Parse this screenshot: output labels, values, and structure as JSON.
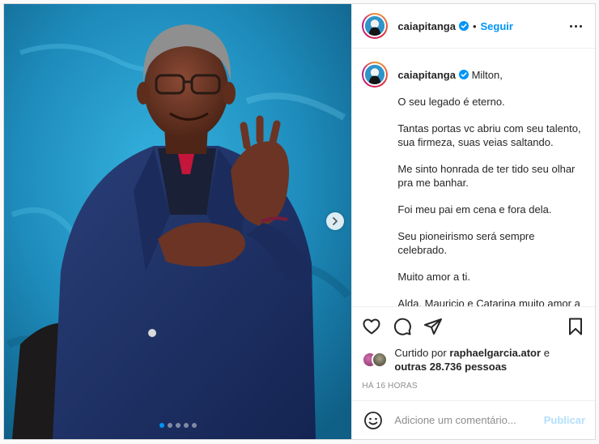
{
  "post": {
    "carousel": {
      "total_slides": 5,
      "active_slide": 1
    },
    "next_icon": "chevron-right-icon"
  },
  "header": {
    "username": "caiapitanga",
    "separator": "•",
    "follow_label": "Seguir",
    "more_icon": "more-options-icon"
  },
  "caption": {
    "username": "caiapitanga",
    "first_line": "Milton,",
    "paragraphs": [
      "O seu legado é eterno.",
      "Tantas portas vc abriu com seu talento,\nsua firmeza, suas veias saltando.",
      "Me sinto honrada de ter tido seu olhar\npra me banhar.",
      "Foi meu pai em cena e fora dela.",
      "Seu pioneirismo será sempre celebrado.",
      "Muito amor a ti.",
      "Alda, Mauricio e Catarina muito amor a\nvcs."
    ]
  },
  "actions": {
    "icons": [
      "heart-icon",
      "comment-icon",
      "share-icon",
      "bookmark-icon"
    ],
    "liked_prefix": "Curtido por",
    "liked_by": "raphaelgarcia.ator",
    "liked_connector": "e",
    "others": "outras 28.736 pessoas",
    "timestamp": "HÁ 16 HORAS"
  },
  "comment_box": {
    "placeholder": "Adicione um comentário...",
    "publish_label": "Publicar",
    "emoji_icon": "emoji-icon"
  },
  "colors": {
    "accent": "#0095f6",
    "publish_disabled": "#b2dffc",
    "background": "#1f8fbf"
  }
}
